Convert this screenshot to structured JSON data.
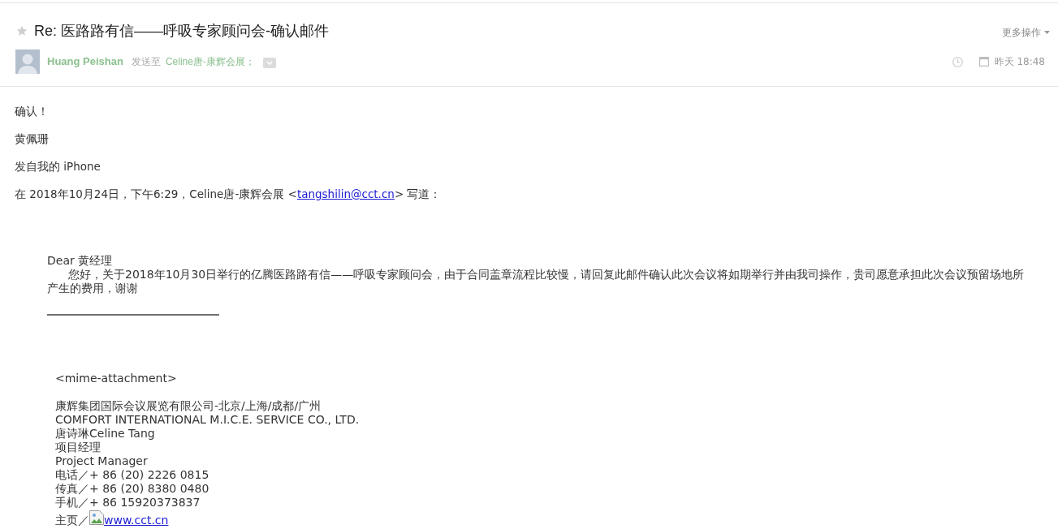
{
  "subject": {
    "starred": false,
    "title": "Re: 医路路有信——呼吸专家顾问会-确认邮件"
  },
  "more_actions": "更多操作",
  "sender": {
    "name": "Huang Peishan",
    "sent_to_label": "发送至",
    "recipients": [
      "Celine唐-康辉会展；"
    ],
    "time": "昨天 18:48"
  },
  "body": {
    "lines": [
      "确认！",
      "黄佩珊",
      "发自我的 iPhone"
    ],
    "quote_header": {
      "before": "在 2018年10月24日，下午6:29，Celine唐-康辉会展 <",
      "email": "tangshilin@cct.cn",
      "after": "> 写道："
    }
  },
  "quoted": {
    "greeting": "Dear 黄经理",
    "paragraph": "您好，关于2018年10月30日举行的亿腾医路路有信——呼吸专家顾问会，由于合同盖章流程比较慢，请回复此邮件确认此次会议将如期举行并由我司操作，贵司愿意承担此次会议预留场地所产生的费用，谢谢",
    "attachment": "<mime-attachment>",
    "signature": [
      "康辉集团国际会议展览有限公司-北京/上海/成都/广州",
      "COMFORT INTERNATIONAL M.I.C.E. SERVICE CO., LTD.",
      "唐诗琳Celine Tang",
      "项目经理",
      "Project Manager",
      "电话／+ 86 (20) 2226 0815",
      "传真／+ 86 (20) 8380 0480",
      "手机／+ 86 15920373837"
    ],
    "homepage": {
      "label": "主页／",
      "link": "www.cct.cn"
    }
  }
}
